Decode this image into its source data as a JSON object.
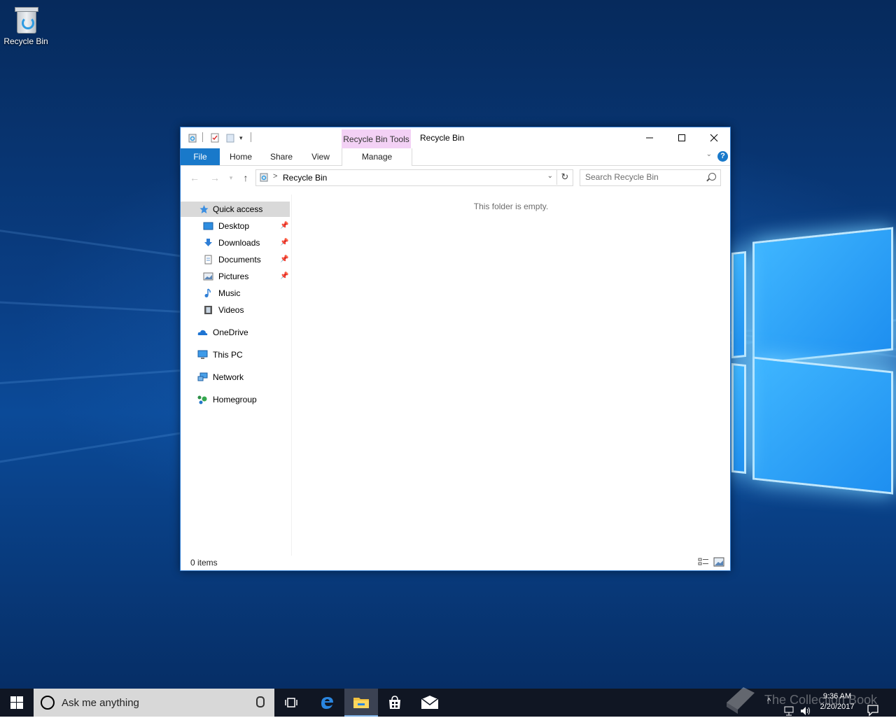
{
  "desktop": {
    "icons": [
      {
        "label": "Recycle Bin"
      }
    ]
  },
  "window": {
    "title": "Recycle Bin",
    "context_tab_group": "Recycle Bin Tools",
    "ribbon_tabs": [
      "File",
      "Home",
      "Share",
      "View",
      "Manage"
    ],
    "help_label": "?",
    "address": {
      "path": "Recycle Bin",
      "separator": ">"
    },
    "search": {
      "placeholder": "Search Recycle Bin"
    },
    "nav_pane": {
      "quick_access": "Quick access",
      "pinned": [
        {
          "label": "Desktop",
          "icon": "desktop-icon"
        },
        {
          "label": "Downloads",
          "icon": "downloads-icon"
        },
        {
          "label": "Documents",
          "icon": "documents-icon"
        },
        {
          "label": "Pictures",
          "icon": "pictures-icon"
        }
      ],
      "unpinned": [
        {
          "label": "Music",
          "icon": "music-icon"
        },
        {
          "label": "Videos",
          "icon": "videos-icon"
        }
      ],
      "roots": [
        {
          "label": "OneDrive",
          "icon": "onedrive-icon"
        },
        {
          "label": "This PC",
          "icon": "this-pc-icon"
        },
        {
          "label": "Network",
          "icon": "network-icon"
        },
        {
          "label": "Homegroup",
          "icon": "homegroup-icon"
        }
      ]
    },
    "content": {
      "empty_message": "This folder is empty."
    },
    "status": {
      "item_count": "0 items"
    }
  },
  "taskbar": {
    "search_text": "Ask me anything",
    "apps": [
      "task-view-icon",
      "edge-icon",
      "file-explorer-icon",
      "store-icon",
      "mail-icon"
    ],
    "clock": {
      "time": "9:36 AM",
      "date": "2/20/2017"
    }
  },
  "watermark": {
    "text": "The Collection Book"
  },
  "colors": {
    "accent": "#1979ca",
    "context_tab": "#f3d1f5",
    "taskbar": "#101623",
    "selection": "#d9d9d9"
  }
}
